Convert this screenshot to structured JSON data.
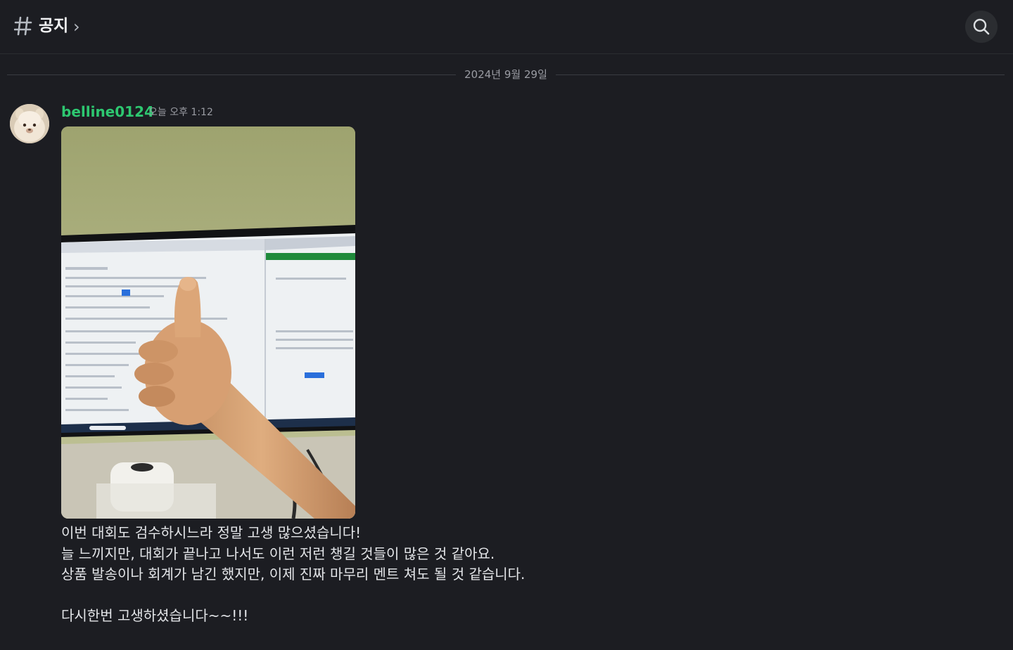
{
  "header": {
    "channel_name": "공지",
    "chevron": "›",
    "search_icon": "search-icon",
    "hash_icon": "hash-icon"
  },
  "date_divider": {
    "label": "2024년 9월 29일"
  },
  "message": {
    "author": "belline0124",
    "author_color": "#2dc770",
    "timestamp": "오늘 오후 1:12",
    "attachment": "thumbs-up photo in front of monitor",
    "lines": [
      "이번 대회도 검수하시느라 정말 고생 많으셨습니다!",
      "늘 느끼지만, 대회가 끝나고 나서도 이런 저런 챙길 것들이 많은 것 같아요.",
      "상품 발송이나 회계가 남긴 했지만, 이제 진짜 마무리 멘트 쳐도 될 것 같습니다."
    ],
    "closing": "다시한번 고생하셨습니다~~!!!"
  }
}
